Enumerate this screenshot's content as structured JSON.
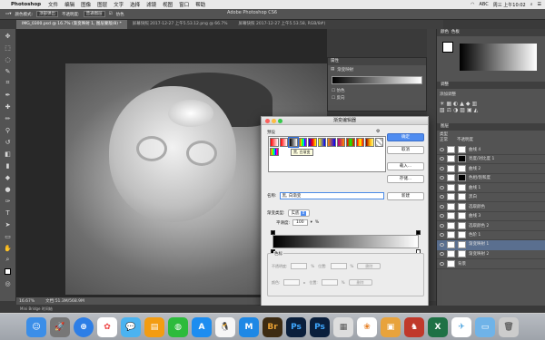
{
  "menubar": {
    "app": "Photoshop",
    "items": [
      "文件",
      "编辑",
      "图像",
      "图层",
      "文字",
      "选择",
      "滤镜",
      "视图",
      "窗口",
      "帮助"
    ],
    "clock": "周三 上午10:02",
    "status_right": "ABC"
  },
  "options": {
    "mode_label": "颜色模式:",
    "mode_value": "顶部弹出",
    "opacity_label": "不透明度:",
    "opacity_value": "普通图层",
    "check_label": "仿色",
    "reverse_label": "反向"
  },
  "app_title": "Adobe Photoshop CS6",
  "tabs": [
    {
      "label": "IMG_0300.psd @ 16.7% (渐变映射 1, 图层蒙版/8) *",
      "active": true
    },
    {
      "label": "屏幕快照 2017-12-27 上午5.53.12.png @ 66.7%",
      "active": false
    },
    {
      "label": "屏幕快照 2017-12-27 上午5.53.58, RGB/8#)",
      "active": false
    }
  ],
  "statusbar": {
    "zoom": "16.67%",
    "doc": "文档:51.3M/568.9M"
  },
  "grad_panel": {
    "title": "属性",
    "subtitle": "渐变映射",
    "opt1": "仿色",
    "opt2": "反向"
  },
  "right_panels": {
    "color_tab": "颜色",
    "swatch_tab": "色板",
    "adjust_tab": "调整",
    "adjust_label": "添加调整",
    "layers_tab": "图层",
    "layers_kind": "类型",
    "layers_blend": "正常",
    "layers_opacity": "不透明度",
    "layers": [
      {
        "name": "曲线 4",
        "selected": false
      },
      {
        "name": "亮度/对比度 1",
        "selected": false
      },
      {
        "name": "曲线 2",
        "selected": false
      },
      {
        "name": "色相/饱和度",
        "selected": false
      },
      {
        "name": "曲线 1",
        "selected": false
      },
      {
        "name": "黑白",
        "selected": false
      },
      {
        "name": "选取颜色",
        "selected": false
      },
      {
        "name": "曲线 3",
        "selected": false
      },
      {
        "name": "选取颜色 2",
        "selected": false
      },
      {
        "name": "色阶 1",
        "selected": false
      },
      {
        "name": "渐变映射 1",
        "selected": true
      },
      {
        "name": "渐变映射 2",
        "selected": false
      },
      {
        "name": "背景",
        "selected": false
      }
    ]
  },
  "dialog": {
    "title": "渐变编辑器",
    "presets_label": "预设",
    "tooltip": "黑, 白渐变",
    "buttons": {
      "ok": "确定",
      "cancel": "取消",
      "load": "载入...",
      "save": "存储..."
    },
    "name_label": "名称:",
    "name_value": "黑, 白渐变",
    "new_button": "新建",
    "type_label": "渐变类型:",
    "type_value": "实底",
    "smooth_label": "平滑度:",
    "smooth_value": "100",
    "smooth_unit": "%",
    "stops_caption": "色标",
    "opacity_label": "不透明度:",
    "location_label": "位置:",
    "delete_label": "删除",
    "color_label": "颜色:",
    "percent": "%"
  },
  "bottom_status": "Mini Bridge   时间轴",
  "dock": [
    "Finder",
    "Launchpad",
    "Safari",
    "Photos",
    "Messages",
    "Books",
    "WeChat",
    "App Store",
    "QQ",
    "Maxthon",
    "Bridge",
    "Photoshop",
    "Photoshop",
    "Preview",
    "Photos",
    "Boxes",
    "Sparrow",
    "Excel",
    "Pigeon",
    "Folder",
    "Trash"
  ]
}
